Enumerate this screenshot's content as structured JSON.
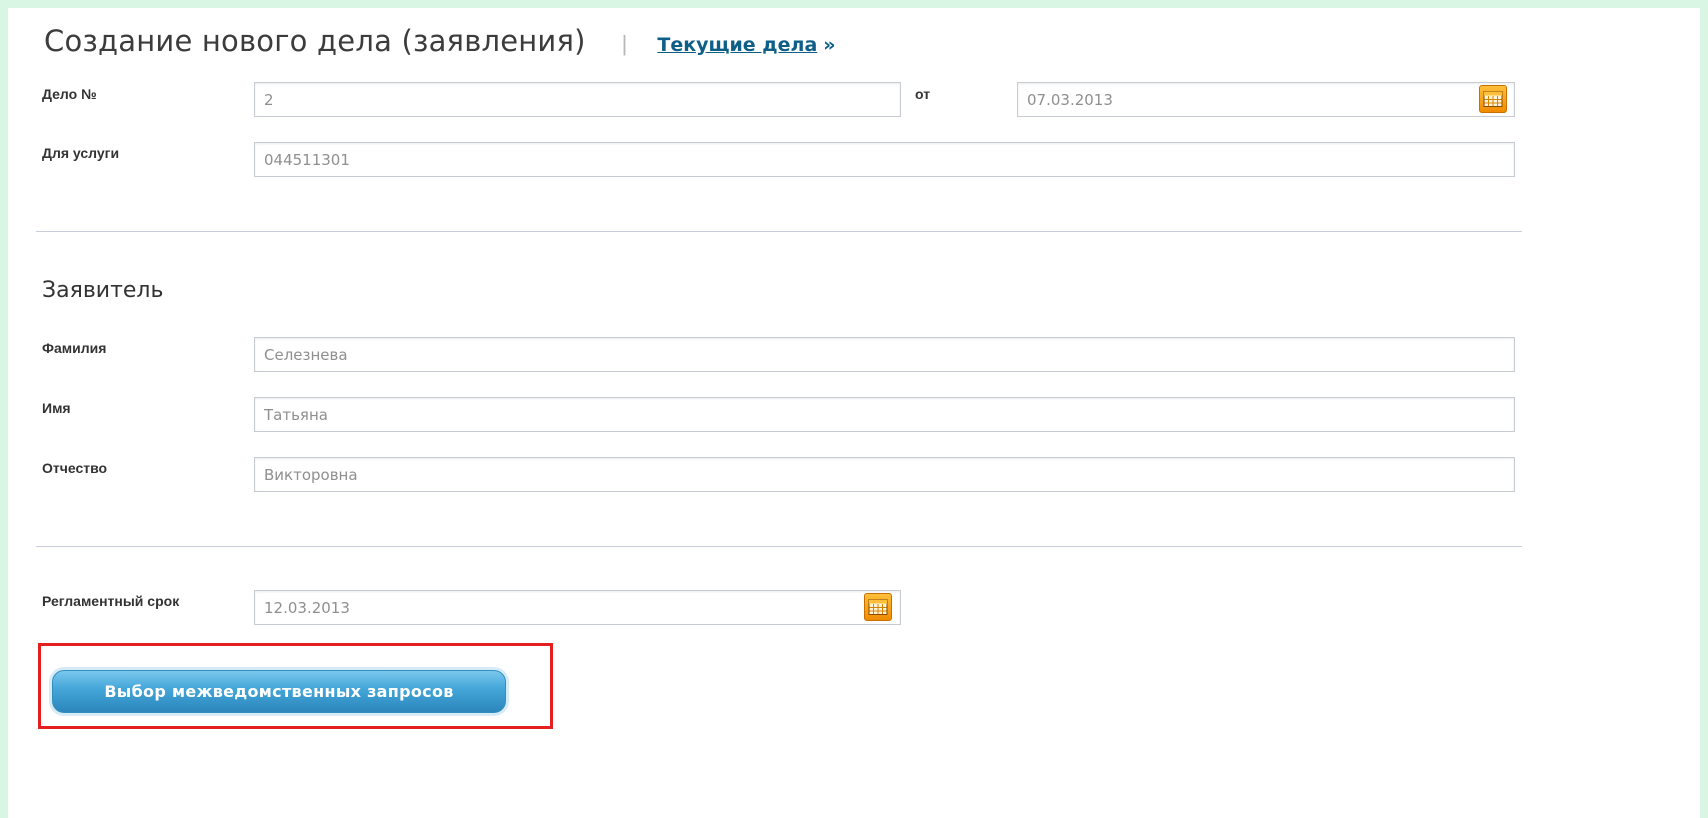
{
  "header": {
    "title": "Создание нового дела (заявления)",
    "separator": "|",
    "current_cases_link": "Текущие дела",
    "link_arrow": "»"
  },
  "case": {
    "number_label": "Дело №",
    "number_value": "2",
    "from_label": "от",
    "date_value": "07.03.2013",
    "service_label": "Для услуги",
    "service_value": "044511301"
  },
  "applicant": {
    "section_title": "Заявитель",
    "surname_label": "Фамилия",
    "surname_value": "Селезнева",
    "name_label": "Имя",
    "name_value": "Татьяна",
    "patronymic_label": "Отчество",
    "patronymic_value": "Викторовна"
  },
  "deadline": {
    "label": "Регламентный срок",
    "value": "12.03.2013"
  },
  "actions": {
    "select_requests_button": "Выбор межведомственных запросов"
  },
  "icons": {
    "calendar": "calendar-icon"
  },
  "colors": {
    "background": "#d9f5e3",
    "link": "#0d5f87",
    "calendar_button": "#f08b00",
    "primary_button": "#45a7d9",
    "highlight_frame": "#e31f1f"
  }
}
